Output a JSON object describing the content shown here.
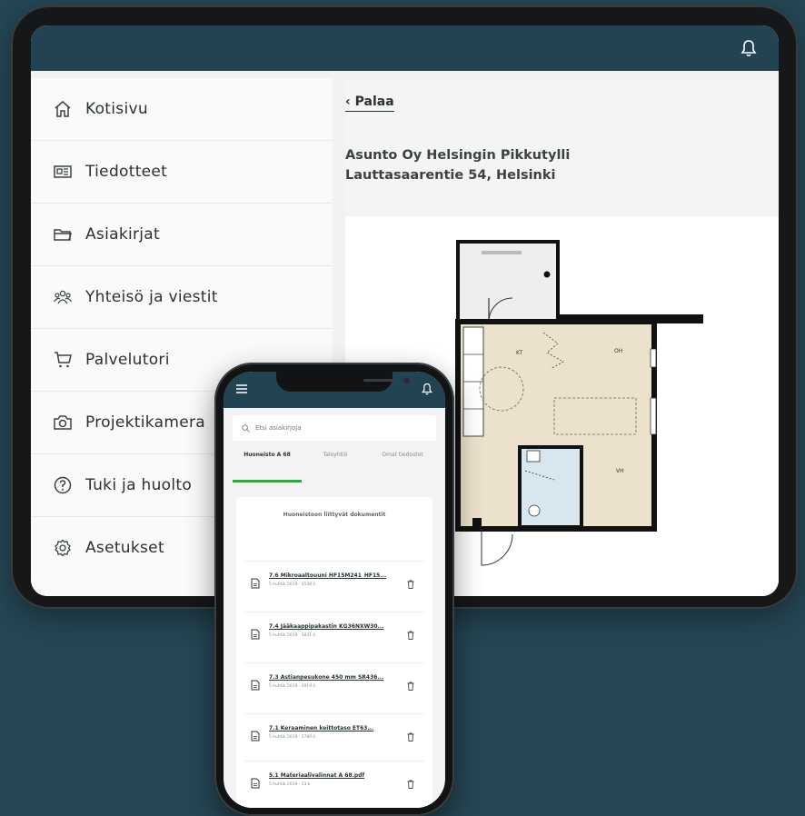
{
  "tablet": {
    "nav": [
      {
        "label": "Kotisivu",
        "icon": "home-icon"
      },
      {
        "label": "Tiedotteet",
        "icon": "news-icon"
      },
      {
        "label": "Asiakirjat",
        "icon": "folder-icon"
      },
      {
        "label": "Yhteisö ja viestit",
        "icon": "community-icon"
      },
      {
        "label": "Palvelutori",
        "icon": "cart-icon"
      },
      {
        "label": "Projektikamera",
        "icon": "camera-icon"
      },
      {
        "label": "Tuki ja huolto",
        "icon": "help-icon"
      },
      {
        "label": "Asetukset",
        "icon": "settings-icon"
      }
    ],
    "back_label": "Palaa",
    "title_line1": "Asunto Oy Helsingin Pikkutylli",
    "title_line2": "Lauttasaarentie 54, Helsinki"
  },
  "phone": {
    "search_placeholder": "Etsi asiakirjoja",
    "tabs": [
      {
        "label": "Huoneisto A 68",
        "active": true
      },
      {
        "label": "Taloyhtiö",
        "active": false
      },
      {
        "label": "Omat tiedostot",
        "active": false
      }
    ],
    "card_title": "Huoneistoon liittyvät dokumentit",
    "documents": [
      {
        "name": "7.6 Mikroaaltouuni HF15M241_HF15...",
        "meta": "5 huhtik 2019 · 3538 k"
      },
      {
        "name": "7.4 Jääkaappipakastin KG36NXW30...",
        "meta": "5 huhtik 2019 · 3831 k"
      },
      {
        "name": "7.3 Astianpesukone 450 mm SR436...",
        "meta": "5 huhtik 2019 · 3919 k"
      },
      {
        "name": "7.1 Keraaminen keittotaso ET63...",
        "meta": "5 huhtik 2019 · 1780 k"
      },
      {
        "name": "5.1 Materiaalivalinnat A 68.pdf",
        "meta": "5 huhtik 2019 · 13 k"
      }
    ]
  },
  "colors": {
    "background": "#254654",
    "header": "#224452",
    "accent_green": "#3aa04b",
    "floor_beige": "#ede3cf",
    "bathroom_blue": "#d7e6ef"
  }
}
